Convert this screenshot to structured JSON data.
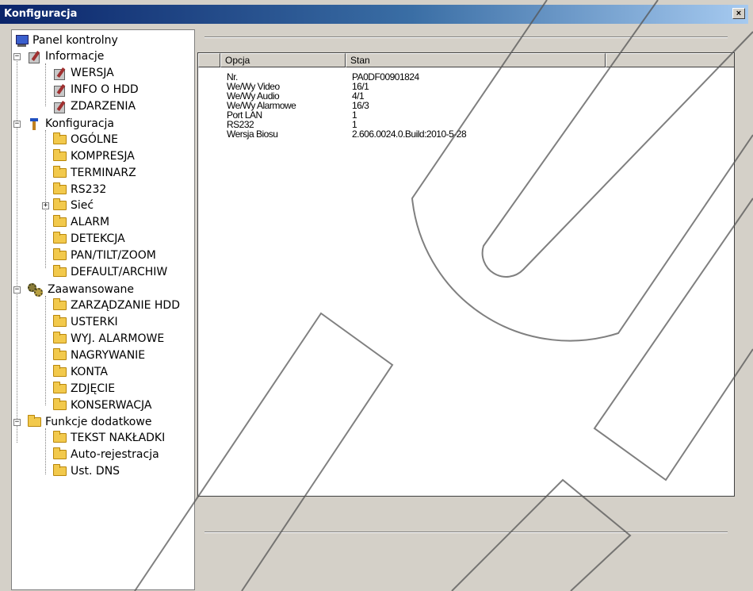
{
  "window": {
    "title": "Konfiguracja",
    "close_label": "×"
  },
  "tree": {
    "root": "Panel kontrolny",
    "informacje": {
      "label": "Informacje",
      "items": [
        "WERSJA",
        "INFO O HDD",
        "ZDARZENIA"
      ]
    },
    "konfiguracja": {
      "label": "Konfiguracja",
      "items": [
        "OGÓLNE",
        "KOMPRESJA",
        "TERMINARZ",
        "RS232",
        "Sieć",
        "ALARM",
        "DETEKCJA",
        "PAN/TILT/ZOOM",
        "DEFAULT/ARCHIW"
      ]
    },
    "zaawansowane": {
      "label": "Zaawansowane",
      "items": [
        "ZARZĄDZANIE HDD",
        "USTERKI",
        "WYJ. ALARMOWE",
        "NAGRYWANIE",
        "KONTA",
        "ZDJĘCIE",
        "KONSERWACJA"
      ]
    },
    "funkcje": {
      "label": "Funkcje dodatkowe",
      "items": [
        "TEKST NAKŁADKI",
        "Auto-rejestracja",
        "Ust. DNS"
      ]
    }
  },
  "table": {
    "headers": [
      "Opcja",
      "Stan"
    ],
    "rows": [
      [
        "Nr.",
        "PA0DF00901824"
      ],
      [
        "We/Wy Video",
        "16/1"
      ],
      [
        "We/Wy Audio",
        "4/1"
      ],
      [
        "We/Wy Alarmowe",
        "16/3"
      ],
      [
        "Port LAN",
        "1"
      ],
      [
        "RS232",
        "1"
      ],
      [
        "Wersja Biosu",
        "2.606.0024.0.Build:2010-5-28"
      ]
    ]
  },
  "colors": {
    "titlebar_start": "#0a246a",
    "titlebar_end": "#a6caf0",
    "panel_bg": "#d4d0c8",
    "content_bg": "#ffffff"
  },
  "icons": {
    "root": "monitor-icon",
    "informacje": "note-icon",
    "konfiguracja": "tools-icon",
    "zaawansowane": "gears-icon",
    "funkcje": "folder-icon",
    "leaf": "folder-icon"
  }
}
